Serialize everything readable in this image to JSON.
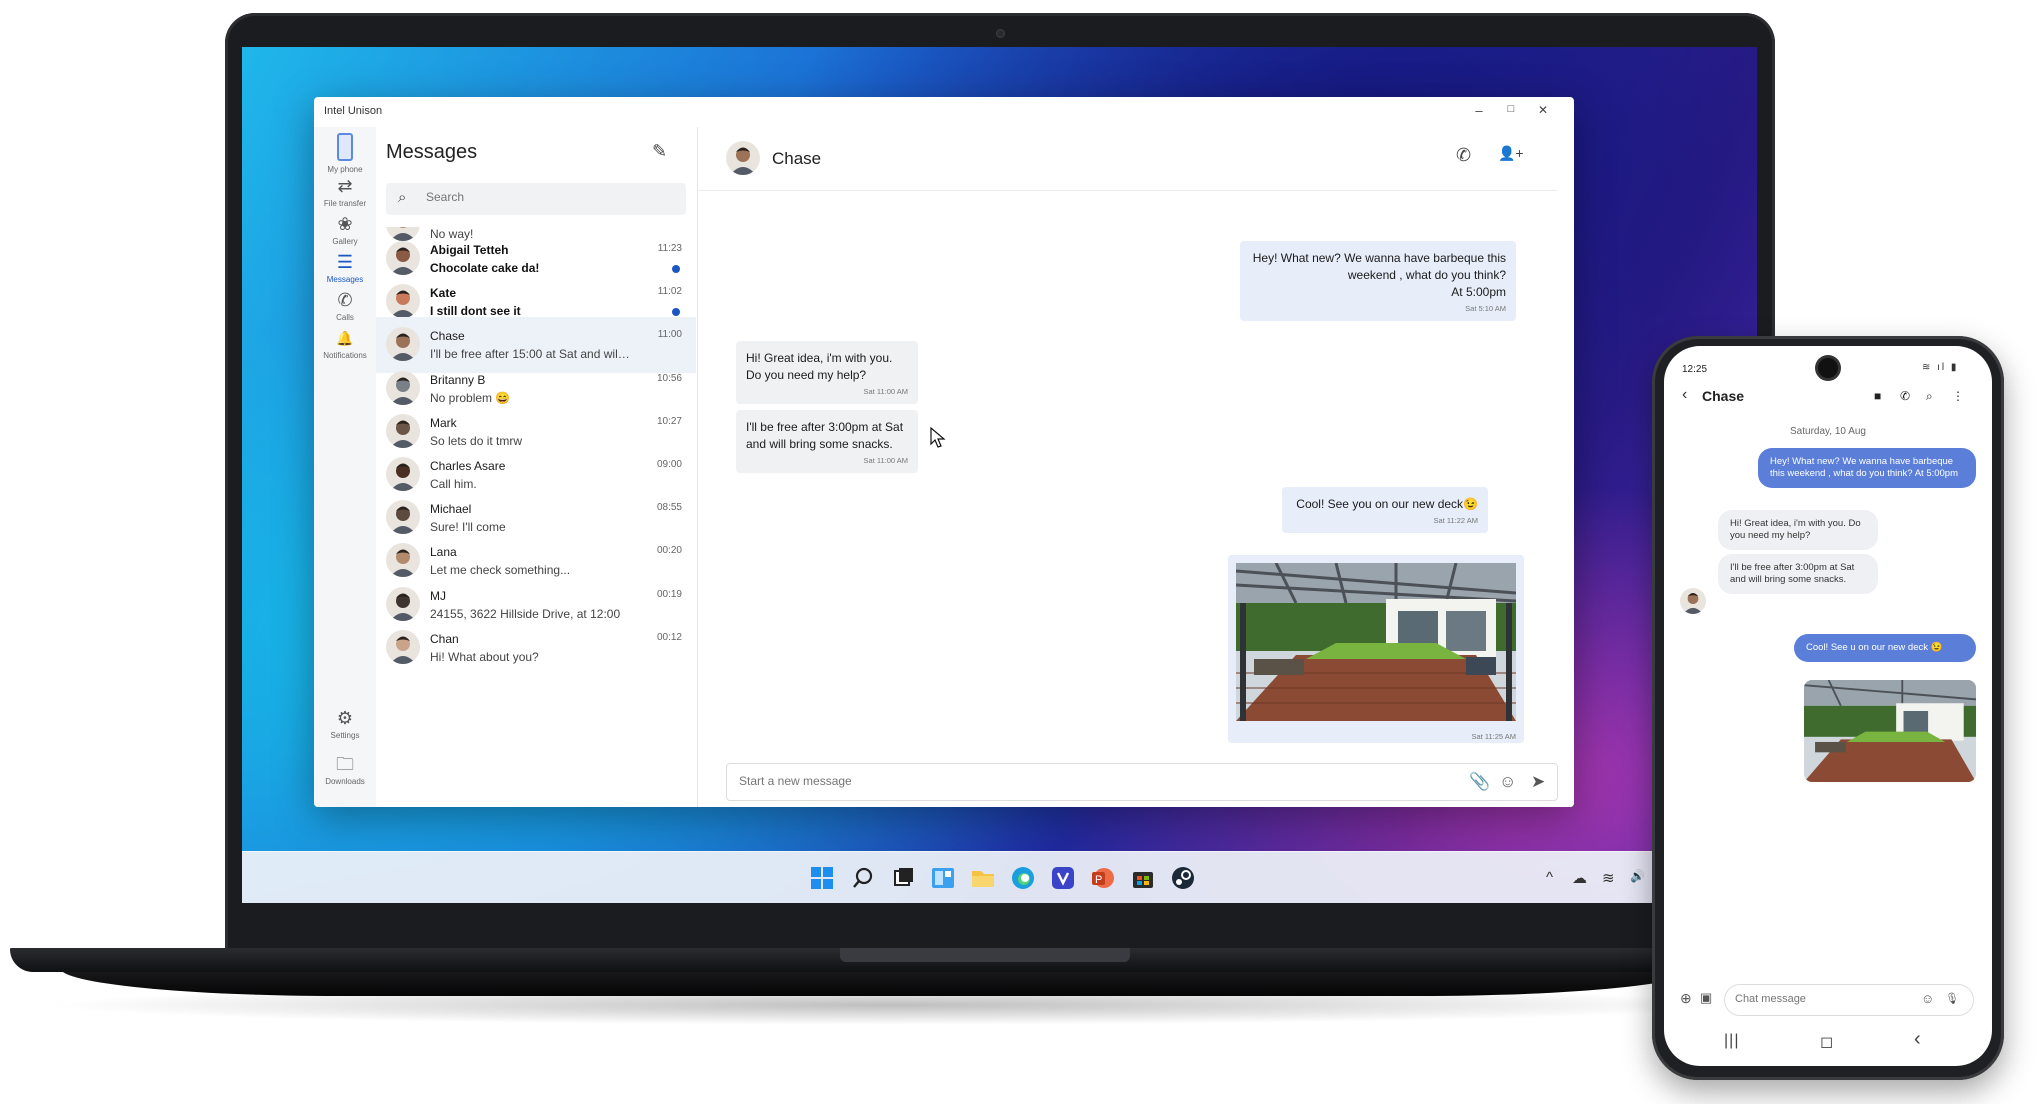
{
  "window": {
    "title": "Intel Unison",
    "minimize": "–",
    "maximize": "□",
    "close": "✕"
  },
  "rail": [
    {
      "label": "My phone",
      "icon": "▯"
    },
    {
      "label": "File transfer",
      "icon": "⇄"
    },
    {
      "label": "Gallery",
      "icon": "❀"
    },
    {
      "label": "Messages",
      "icon": "☰"
    },
    {
      "label": "Calls",
      "icon": "✆"
    },
    {
      "label": "Notifications",
      "icon": "🔔"
    },
    {
      "label": "Settings",
      "icon": "⚙"
    },
    {
      "label": "Downloads",
      "icon": "🗀"
    }
  ],
  "list": {
    "title": "Messages",
    "compose_icon": "✎",
    "search_placeholder": "Search",
    "search_icon": "⌕"
  },
  "conversations": [
    {
      "name": "",
      "preview": "No way!",
      "time": "",
      "unread": false,
      "bold": false,
      "avatar": "#b58a6e"
    },
    {
      "name": "Abigail Tetteh",
      "preview": "Chocolate cake da!",
      "time": "11:23",
      "unread": true,
      "bold": true,
      "avatar": "#8a5a44"
    },
    {
      "name": "Kate",
      "preview": "I still dont see it",
      "time": "11:02",
      "unread": true,
      "bold": true,
      "avatar": "#c97a5a"
    },
    {
      "name": "Chase",
      "preview": "I'll be free after 15:00 at Sat and will...",
      "time": "11:00",
      "unread": false,
      "bold": false,
      "avatar": "#9c7258",
      "selected": true
    },
    {
      "name": "Britanny B",
      "preview": "No problem 😄",
      "time": "10:56",
      "unread": false,
      "bold": false,
      "avatar": "#7a7f88"
    },
    {
      "name": "Mark",
      "preview": "So lets do it tmrw",
      "time": "10:27",
      "unread": false,
      "bold": false,
      "avatar": "#6b5647"
    },
    {
      "name": "Charles Asare",
      "preview": "Call him.",
      "time": "09:00",
      "unread": false,
      "bold": false,
      "avatar": "#4a3024"
    },
    {
      "name": "Michael",
      "preview": "Sure! I'll come",
      "time": "08:55",
      "unread": false,
      "bold": false,
      "avatar": "#5d4a3f"
    },
    {
      "name": "Lana",
      "preview": "Let me check something...",
      "time": "00:20",
      "unread": false,
      "bold": false,
      "avatar": "#b48a6e"
    },
    {
      "name": "MJ",
      "preview": "24155, 3622 Hillside Drive, at 12:00",
      "time": "00:19",
      "unread": false,
      "bold": false,
      "avatar": "#3e3430"
    },
    {
      "name": "Chan",
      "preview": "Hi! What about you?",
      "time": "00:12",
      "unread": false,
      "bold": false,
      "avatar": "#c9a48a"
    }
  ],
  "chat": {
    "contact": "Chase",
    "call_icon": "✆",
    "add_person_icon": "👤+",
    "messages": [
      {
        "dir": "out",
        "text": "Hey! What new? We wanna have barbeque this weekend , what do you think?\nAt 5:00pm",
        "time": "Sat 5:10 AM"
      },
      {
        "dir": "in",
        "text": "Hi! Great idea, i'm with you.\nDo you need my help?",
        "time": "Sat 11:00 AM"
      },
      {
        "dir": "in",
        "text": "I'll be free after 3:00pm at Sat\nand will bring some snacks.",
        "time": "Sat 11:00 AM"
      },
      {
        "dir": "out",
        "text": "Cool! See you on our new deck😉",
        "time": "Sat 11:22 AM"
      }
    ],
    "photo_time": "Sat 11:25 AM",
    "compose_placeholder": "Start a new message",
    "attach_icon": "📎",
    "emoji_icon": "☺",
    "send_icon": "➤"
  },
  "taskbar": {
    "tray": [
      "^",
      "☁",
      "≋",
      "🔊"
    ]
  },
  "phone": {
    "time": "12:25",
    "status": "≋ ıl ▮",
    "back_icon": "‹",
    "contact": "Chase",
    "actions": [
      "■",
      "✆",
      "⌕",
      "⋮"
    ],
    "date": "Saturday, 10 Aug",
    "messages": [
      {
        "dir": "out",
        "text": "Hey! What new? We wanna have barbeque this weekend , what do you think? At 5:00pm"
      },
      {
        "dir": "in",
        "text": "Hi! Great idea, i'm with you. Do you need my help?"
      },
      {
        "dir": "in",
        "text": "I'll be free after 3:00pm at Sat and will bring some snacks."
      },
      {
        "dir": "out",
        "text": "Cool! See u on our new deck 😉"
      }
    ],
    "input_placeholder": "Chat message",
    "add_icon": "⊕",
    "gallery_icon": "▣",
    "emoji_icon": "☺",
    "mic_icon": "🎙",
    "nav": [
      "|||",
      "◻",
      "‹"
    ]
  }
}
